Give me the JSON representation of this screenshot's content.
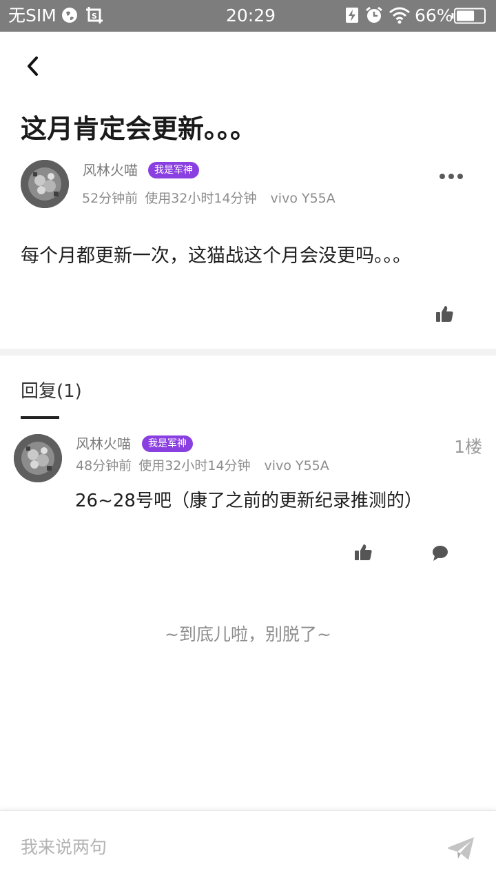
{
  "status_bar": {
    "carrier": "无SIM",
    "time": "20:29",
    "battery_percent": "66%",
    "battery_level": 0.66,
    "icons": [
      "globe-icon",
      "screenshot-icon",
      "charging-icon",
      "alarm-icon",
      "wifi-icon",
      "battery-icon"
    ]
  },
  "post": {
    "title": "这月肯定会更新。。。",
    "author": {
      "name": "风林火喵",
      "badge": "我是军神"
    },
    "meta": {
      "time_ago": "52分钟前",
      "usage": "使用32小时14分钟",
      "device": "vivo Y55A"
    },
    "body": "每个月都更新一次，这猫战这个月会没更吗。。。"
  },
  "replies": {
    "header": "回复(1)",
    "items": [
      {
        "author": "风林火喵",
        "badge": "我是军神",
        "time_ago": "48分钟前",
        "usage": "使用32小时14分钟",
        "device": "vivo Y55A",
        "floor": "1楼",
        "body": "26~28号吧（康了之前的更新纪录推测的）"
      }
    ]
  },
  "end_text": "~到底儿啦，别脱了~",
  "composer": {
    "placeholder": "我来说两句"
  },
  "colors": {
    "status_bar": "#7d7d7d",
    "badge": "#8a3fe0",
    "divider": "#f2f2f2",
    "icon": "#555555"
  }
}
